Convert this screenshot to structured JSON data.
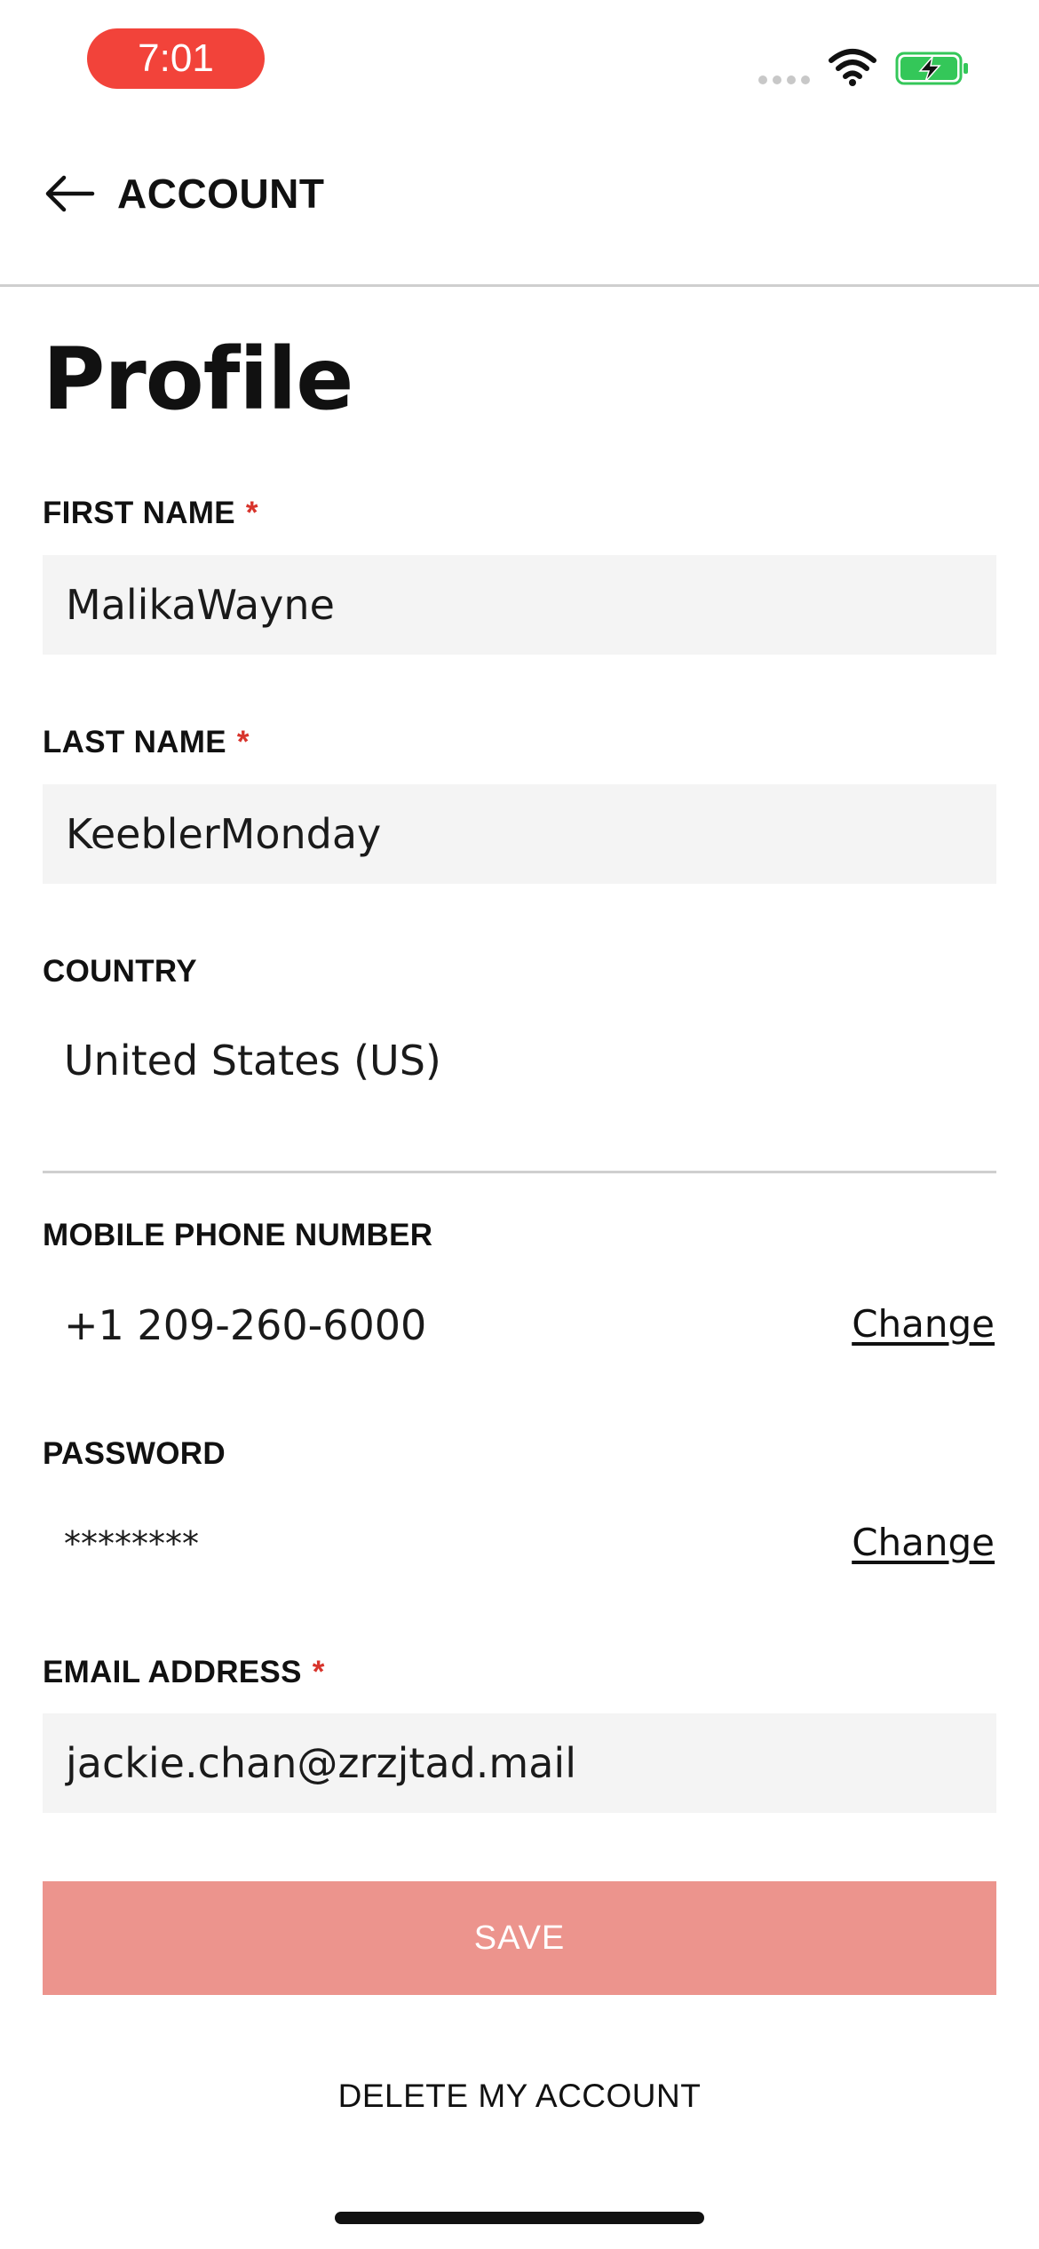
{
  "status_bar": {
    "time": "7:01",
    "icons": [
      "cellular-signal-icon",
      "wifi-icon",
      "battery-charging-icon"
    ],
    "time_pill_color": "#f2433a",
    "battery_color": "#34c759"
  },
  "header": {
    "back_icon": "arrow-left-icon",
    "title": "ACCOUNT"
  },
  "page": {
    "title": "Profile"
  },
  "fields": {
    "first_name": {
      "label": "FIRST NAME",
      "required_mark": "*",
      "value": "MalikaWayne"
    },
    "last_name": {
      "label": "LAST NAME",
      "required_mark": "*",
      "value": "KeeblerMonday"
    },
    "country": {
      "label": "COUNTRY",
      "value": "United States (US)"
    },
    "mobile_phone": {
      "label": "MOBILE PHONE NUMBER",
      "value": "+1 209-260-6000",
      "action": "Change"
    },
    "password": {
      "label": "PASSWORD",
      "value": "********",
      "action": "Change"
    },
    "email": {
      "label": "EMAIL ADDRESS",
      "required_mark": "*",
      "value": "jackie.chan@zrzjtad.mail"
    }
  },
  "actions": {
    "save_label": "SAVE",
    "delete_label": "DELETE MY ACCOUNT"
  },
  "colors": {
    "accent_red": "#d8342c",
    "save_button_disabled": "#ec948d",
    "input_background": "#f4f4f4"
  }
}
